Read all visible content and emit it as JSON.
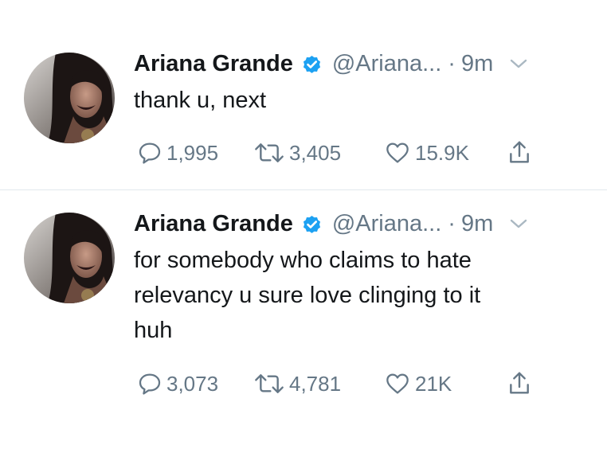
{
  "colors": {
    "verified_badge": "#1da1f2",
    "secondary_text": "#657786",
    "primary_text": "#14171a",
    "divider": "#e1e8ed"
  },
  "tweets": [
    {
      "author_name": "Ariana Grande",
      "handle": "@Ariana...",
      "separator": "·",
      "time": "9m",
      "text_lines": [
        "thank u, next"
      ],
      "reply_count": "1,995",
      "retweet_count": "3,405",
      "like_count": "15.9K",
      "icons": [
        "reply-icon",
        "retweet-icon",
        "like-icon",
        "share-icon"
      ]
    },
    {
      "author_name": "Ariana Grande",
      "handle": "@Ariana...",
      "separator": "·",
      "time": "9m",
      "text_lines": [
        "for somebody who claims to hate",
        "relevancy u sure love clinging to it",
        "huh"
      ],
      "reply_count": "3,073",
      "retweet_count": "4,781",
      "like_count": "21K",
      "icons": [
        "reply-icon",
        "retweet-icon",
        "like-icon",
        "share-icon"
      ]
    }
  ]
}
